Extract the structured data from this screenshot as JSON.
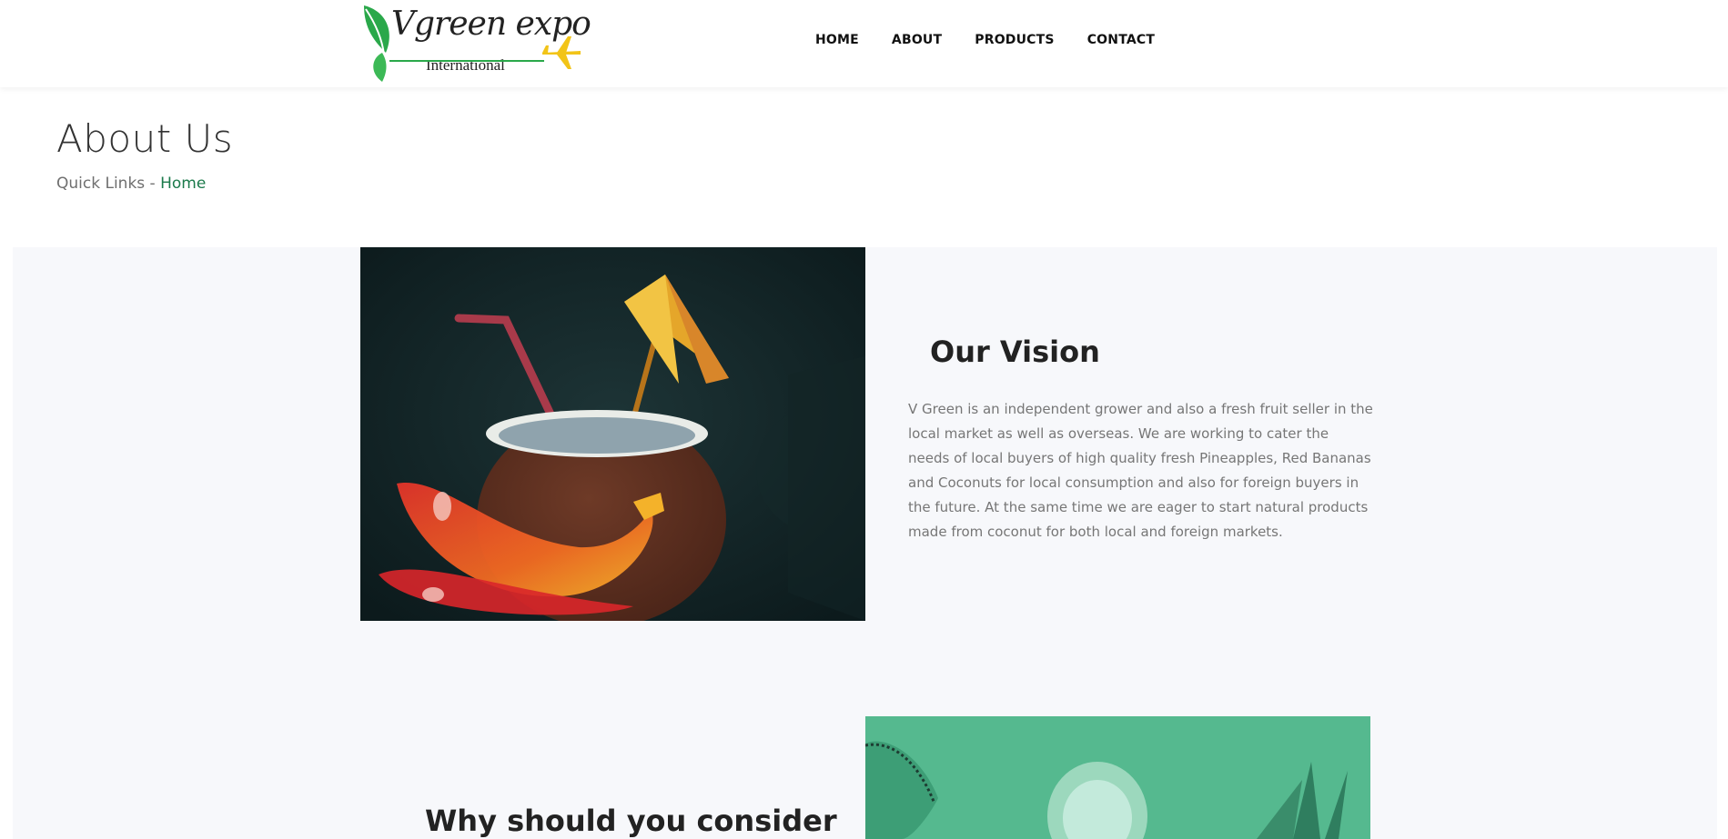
{
  "brand": {
    "name": "Vgreen expo",
    "tagline": "International",
    "colors": {
      "leaf": "#2aa84a",
      "plane": "#f2c418"
    }
  },
  "nav": {
    "items": [
      {
        "label": "HOME"
      },
      {
        "label": "ABOUT"
      },
      {
        "label": "PRODUCTS"
      },
      {
        "label": "CONTACT"
      }
    ]
  },
  "page": {
    "title": "About Us",
    "breadcrumb": {
      "prefix": "Quick Links - ",
      "home": "Home"
    }
  },
  "vision": {
    "title": "Our Vision",
    "text": "V Green is an independent grower and also a fresh fruit seller in the local market as well as overseas. We are working to cater the needs of local buyers of high quality fresh Pineapples, Red Bananas and Coconuts for local consumption and also for foreign buyers in the future. At the same time we are eager to start natural products made from coconut for both local and foreign markets."
  },
  "why": {
    "title": "Why should you consider"
  },
  "colors": {
    "accent": "#1b7a4b",
    "band_bg": "#f7f8fb",
    "image_green": "#55b98f"
  }
}
